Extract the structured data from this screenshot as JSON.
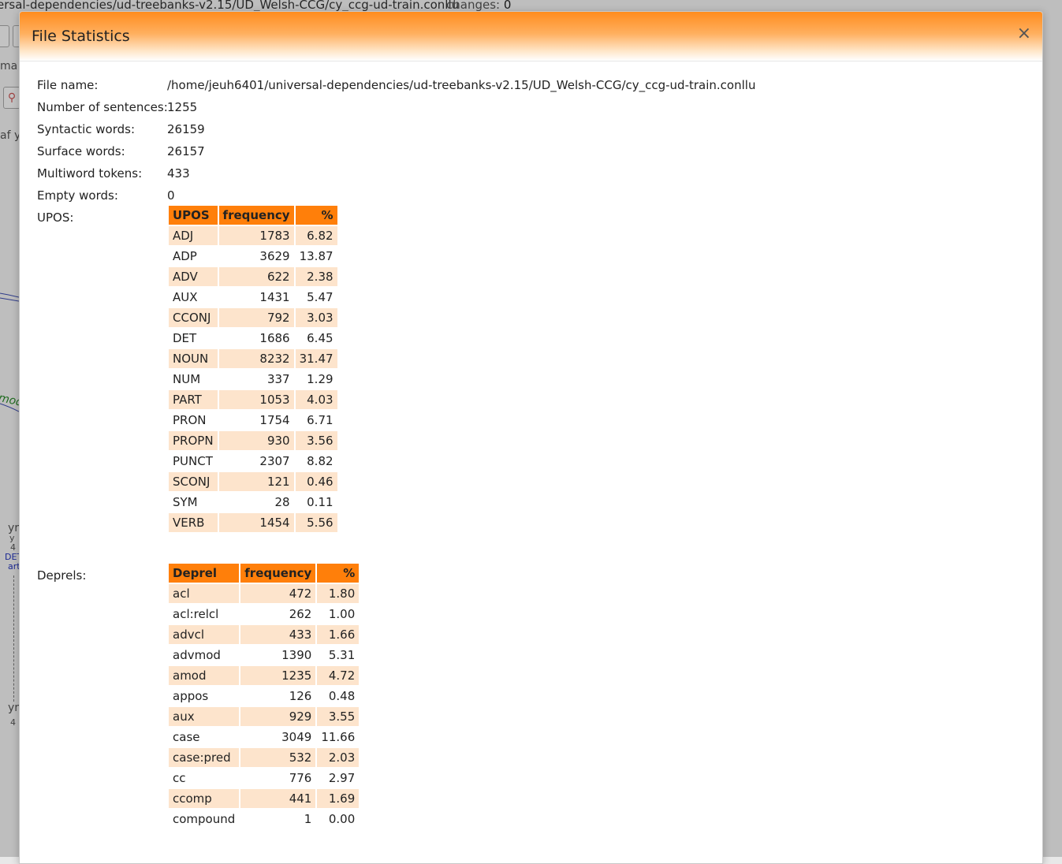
{
  "background": {
    "path_text": "ersal-dependencies/ud-treebanks-v2.15/UD_Welsh-CCG/cy_ccg-ud-train.conllu",
    "changes_label": "changes:",
    "changes_value": "0",
    "frag_1": "ma",
    "frag_2": "af yr",
    "frag_3": "mod",
    "frag_4": "yr",
    "frag_5": "y",
    "frag_6": "4",
    "frag_7": "DET",
    "frag_8": "art",
    "frag_9": "yr",
    "frag_10": "4"
  },
  "modal": {
    "title": "File Statistics",
    "close_glyph": "×",
    "fields": {
      "file_name_label": "File name:",
      "file_name_value": "/home/jeuh6401/universal-dependencies/ud-treebanks-v2.15/UD_Welsh-CCG/cy_ccg-ud-train.conllu",
      "sentences_label": "Number of sentences:",
      "sentences_value": "1255",
      "syntactic_label": "Syntactic words:",
      "syntactic_value": "26159",
      "surface_label": "Surface words:",
      "surface_value": "26157",
      "multiword_label": "Multiword tokens:",
      "multiword_value": "433",
      "empty_label": "Empty words:",
      "empty_value": "0",
      "upos_label": "UPOS:",
      "deprels_label": "Deprels:"
    },
    "upos_table": {
      "headers": [
        "UPOS",
        "frequency",
        "%"
      ],
      "rows": [
        [
          "ADJ",
          "1783",
          "6.82"
        ],
        [
          "ADP",
          "3629",
          "13.87"
        ],
        [
          "ADV",
          "622",
          "2.38"
        ],
        [
          "AUX",
          "1431",
          "5.47"
        ],
        [
          "CCONJ",
          "792",
          "3.03"
        ],
        [
          "DET",
          "1686",
          "6.45"
        ],
        [
          "NOUN",
          "8232",
          "31.47"
        ],
        [
          "NUM",
          "337",
          "1.29"
        ],
        [
          "PART",
          "1053",
          "4.03"
        ],
        [
          "PRON",
          "1754",
          "6.71"
        ],
        [
          "PROPN",
          "930",
          "3.56"
        ],
        [
          "PUNCT",
          "2307",
          "8.82"
        ],
        [
          "SCONJ",
          "121",
          "0.46"
        ],
        [
          "SYM",
          "28",
          "0.11"
        ],
        [
          "VERB",
          "1454",
          "5.56"
        ]
      ]
    },
    "deprel_table": {
      "headers": [
        "Deprel",
        "frequency",
        "%"
      ],
      "rows": [
        [
          "acl",
          "472",
          "1.80"
        ],
        [
          "acl:relcl",
          "262",
          "1.00"
        ],
        [
          "advcl",
          "433",
          "1.66"
        ],
        [
          "advmod",
          "1390",
          "5.31"
        ],
        [
          "amod",
          "1235",
          "4.72"
        ],
        [
          "appos",
          "126",
          "0.48"
        ],
        [
          "aux",
          "929",
          "3.55"
        ],
        [
          "case",
          "3049",
          "11.66"
        ],
        [
          "case:pred",
          "532",
          "2.03"
        ],
        [
          "cc",
          "776",
          "2.97"
        ],
        [
          "ccomp",
          "441",
          "1.69"
        ],
        [
          "compound",
          "1",
          "0.00"
        ]
      ]
    }
  }
}
